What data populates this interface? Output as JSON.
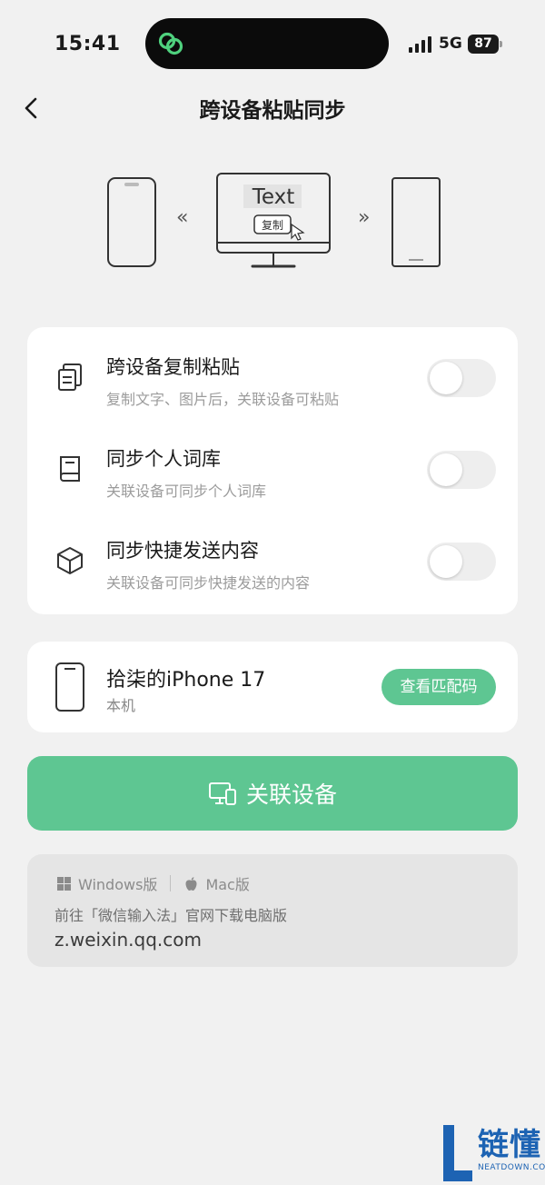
{
  "status_bar": {
    "time": "15:41",
    "network": "5G",
    "battery": "87"
  },
  "nav": {
    "title": "跨设备粘贴同步",
    "back_icon": "chevron-left-icon"
  },
  "illustration": {
    "screen_text": "Text",
    "copy_label": "复制"
  },
  "settings": [
    {
      "icon": "clipboard-copy-icon",
      "title": "跨设备复制粘贴",
      "subtitle": "复制文字、图片后，关联设备可粘贴",
      "enabled": false
    },
    {
      "icon": "book-icon",
      "title": "同步个人词库",
      "subtitle": "关联设备可同步个人词库",
      "enabled": false
    },
    {
      "icon": "cube-icon",
      "title": "同步快捷发送内容",
      "subtitle": "关联设备可同步快捷发送的内容",
      "enabled": false
    }
  ],
  "device": {
    "name": "拾柒的iPhone 17",
    "subtitle": "本机",
    "button": "查看匹配码"
  },
  "link_button": {
    "label": "关联设备"
  },
  "info": {
    "windows": "Windows版",
    "mac": "Mac版",
    "hint": "前往「微信输入法」官网下载电脑版",
    "url": "z.weixin.qq.com"
  },
  "watermark": {
    "text": "链懂",
    "sub": "NEATDOWN.COM"
  },
  "colors": {
    "accent": "#5ec692",
    "background": "#f1f1f1",
    "card": "#ffffff"
  }
}
